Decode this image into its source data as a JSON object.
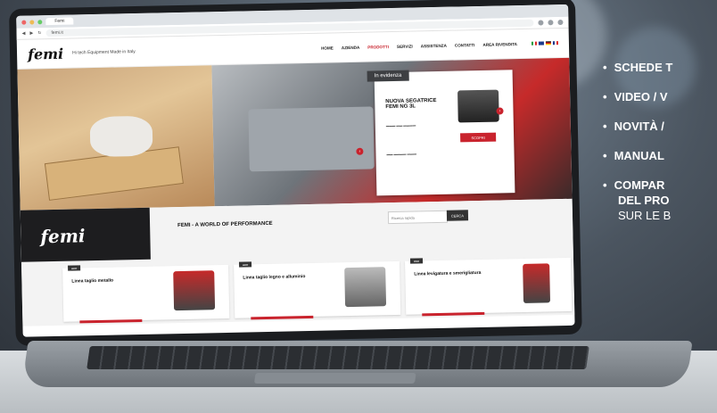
{
  "browser": {
    "tab_label": "Femi",
    "url": "femi.it"
  },
  "site": {
    "logo": "femi",
    "tagline": "Hi tech Equipment Made in Italy",
    "nav": [
      "HOME",
      "AZIENDA",
      "PRODOTTI",
      "SERVIZI",
      "ASSISTENZA",
      "CONTATTI",
      "AREA RIVENDITA"
    ],
    "active_nav": "PRODOTTI"
  },
  "evidence": {
    "label": "In evidenza",
    "product_name": "NUOVA SEGATRICE FEMI NG 3L",
    "button": "SCOPRI"
  },
  "lower": {
    "logo": "femi",
    "title": "FEMI - A WORLD OF PERFORMANCE",
    "search_placeholder": "Ricerca rapida",
    "search_button": "CERCA",
    "cards": [
      {
        "name": "Linea taglio metallo"
      },
      {
        "name": "Linea taglio legno e alluminio"
      },
      {
        "name": "Linea levigatura e smerigliatura"
      }
    ]
  },
  "bullets": [
    "SCHEDE T",
    "VIDEO / V",
    "NOVITÀ /",
    "MANUAL",
    "COMPAR",
    "DEL PRO",
    "SUR LE B"
  ],
  "colors": {
    "accent": "#c9232d",
    "dark": "#1d1d1f"
  }
}
